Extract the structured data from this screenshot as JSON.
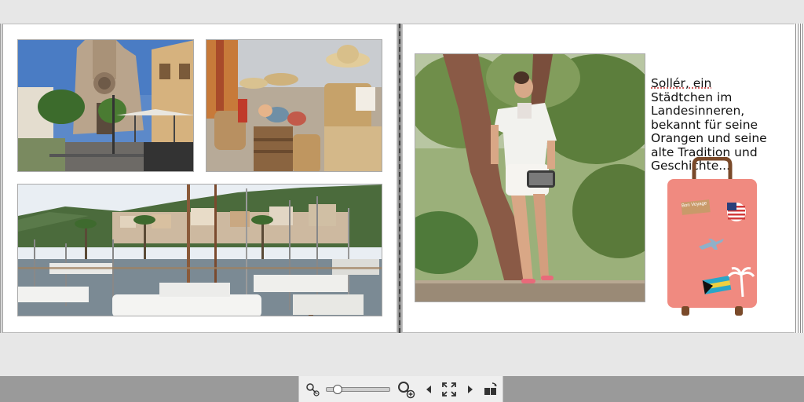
{
  "caption": {
    "lines": [
      "Sollér, ein",
      "Städtchen im",
      "Landesinneren,",
      "bekannt für seine",
      "Orangen und seine",
      "alte Tradition und",
      "Geschichte..."
    ]
  },
  "suitcase": {
    "sticker_text": "Bon Voyage",
    "color": "#f08a80"
  },
  "toolbar": {
    "zoom_level": 0.12,
    "icons": [
      "zoom-out-icon",
      "zoom-slider",
      "zoom-in-icon",
      "previous-page-icon",
      "fullscreen-icon",
      "next-page-icon",
      "page-layout-icon"
    ]
  },
  "photos": [
    {
      "name": "church-street-photo",
      "description_icon": "photo"
    },
    {
      "name": "market-baskets-photo",
      "description_icon": "photo"
    },
    {
      "name": "harbor-boats-photo",
      "description_icon": "photo"
    },
    {
      "name": "woman-tree-photo",
      "description_icon": "photo"
    }
  ]
}
